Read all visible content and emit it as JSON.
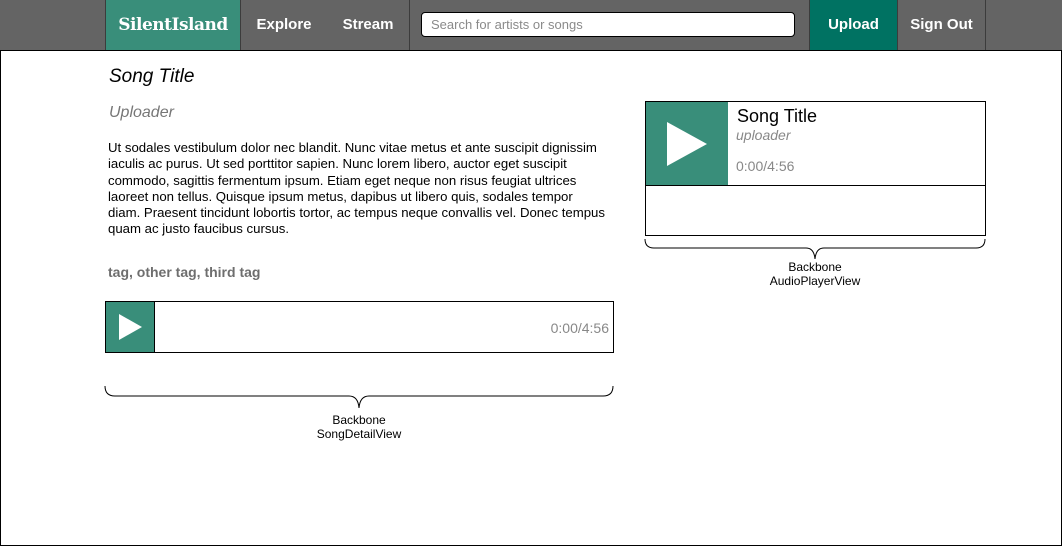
{
  "nav": {
    "logo": "SilentIsland",
    "explore": "Explore",
    "stream": "Stream",
    "search_placeholder": "Search for artists or songs",
    "upload": "Upload",
    "sign_out": "Sign Out"
  },
  "detail": {
    "title": "Song Title",
    "uploader": "Uploader",
    "description": "Ut sodales vestibulum dolor nec blandit. Nunc vitae metus et ante suscipit dignissim iaculis ac purus. Ut sed porttitor sapien. Nunc lorem libero, auctor eget suscipit commodo, sagittis fermentum ipsum. Etiam eget neque non risus feugiat ultrices laoreet non tellus. Quisque ipsum metus, dapibus ut libero quis, sodales tempor diam. Praesent tincidunt lobortis tortor, ac tempus neque convallis vel. Donec tempus quam ac justo faucibus cursus.",
    "tags": "tag, other tag, third tag",
    "player_time": "0:00/4:56",
    "annotation_line1": "Backbone",
    "annotation_line2": "SongDetailView"
  },
  "audio_player": {
    "title": "Song Title",
    "uploader": "uploader",
    "time": "0:00/4:56",
    "annotation_line1": "Backbone",
    "annotation_line2": "AudioPlayerView"
  },
  "icons": {
    "play": "play-icon"
  },
  "colors": {
    "navbar": "#646464",
    "accent": "#398e7a",
    "upload": "#007262"
  }
}
